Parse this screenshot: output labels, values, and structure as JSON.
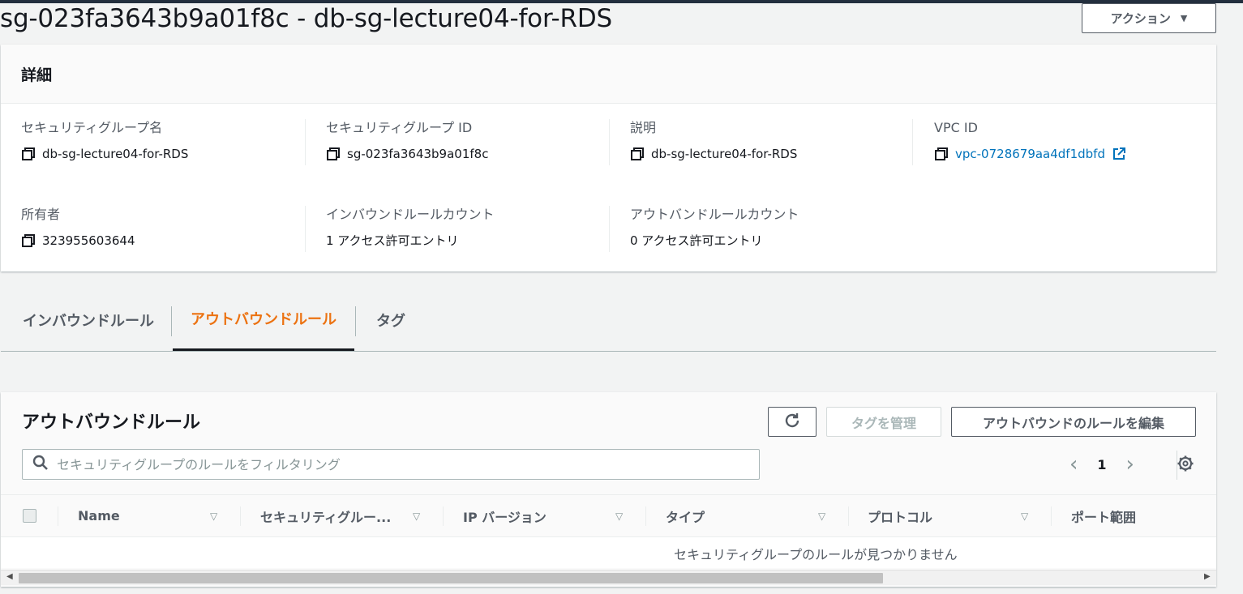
{
  "page": {
    "title": "sg-023fa3643b9a01f8c - db-sg-lecture04-for-RDS",
    "action_button": "アクション"
  },
  "details": {
    "header": "詳細",
    "fields": [
      {
        "label": "セキュリティグループ名",
        "value": "db-sg-lecture04-for-RDS"
      },
      {
        "label": "セキュリティグループ ID",
        "value": "sg-023fa3643b9a01f8c"
      },
      {
        "label": "説明",
        "value": "db-sg-lecture04-for-RDS"
      },
      {
        "label": "VPC ID",
        "value": "vpc-0728679aa4df1dbfd"
      },
      {
        "label": "所有者",
        "value": "323955603644"
      },
      {
        "label": "インバウンドルールカウント",
        "value": "1 アクセス許可エントリ"
      },
      {
        "label": "アウトバンドルールカウント",
        "value": "0 アクセス許可エントリ"
      }
    ]
  },
  "tabs": [
    {
      "label": "インバウンドルール",
      "active": false
    },
    {
      "label": "アウトバウンドルール",
      "active": true
    },
    {
      "label": "タグ",
      "active": false
    }
  ],
  "rules": {
    "title": "アウトバウンドルール",
    "manage_tags_button": "タグを管理",
    "edit_button": "アウトバウンドのルールを編集",
    "search_placeholder": "セキュリティグループのルールをフィルタリング",
    "page_number": "1",
    "columns": [
      "Name",
      "セキュリティグルー...",
      "IP バージョン",
      "タイプ",
      "プロトコル",
      "ポート範囲"
    ],
    "empty_message": "セキュリティグループのルールが見つかりません"
  },
  "colors": {
    "accent_active_tab": "#ec7211",
    "link": "#0073bb",
    "topbar": "#232f3e"
  }
}
